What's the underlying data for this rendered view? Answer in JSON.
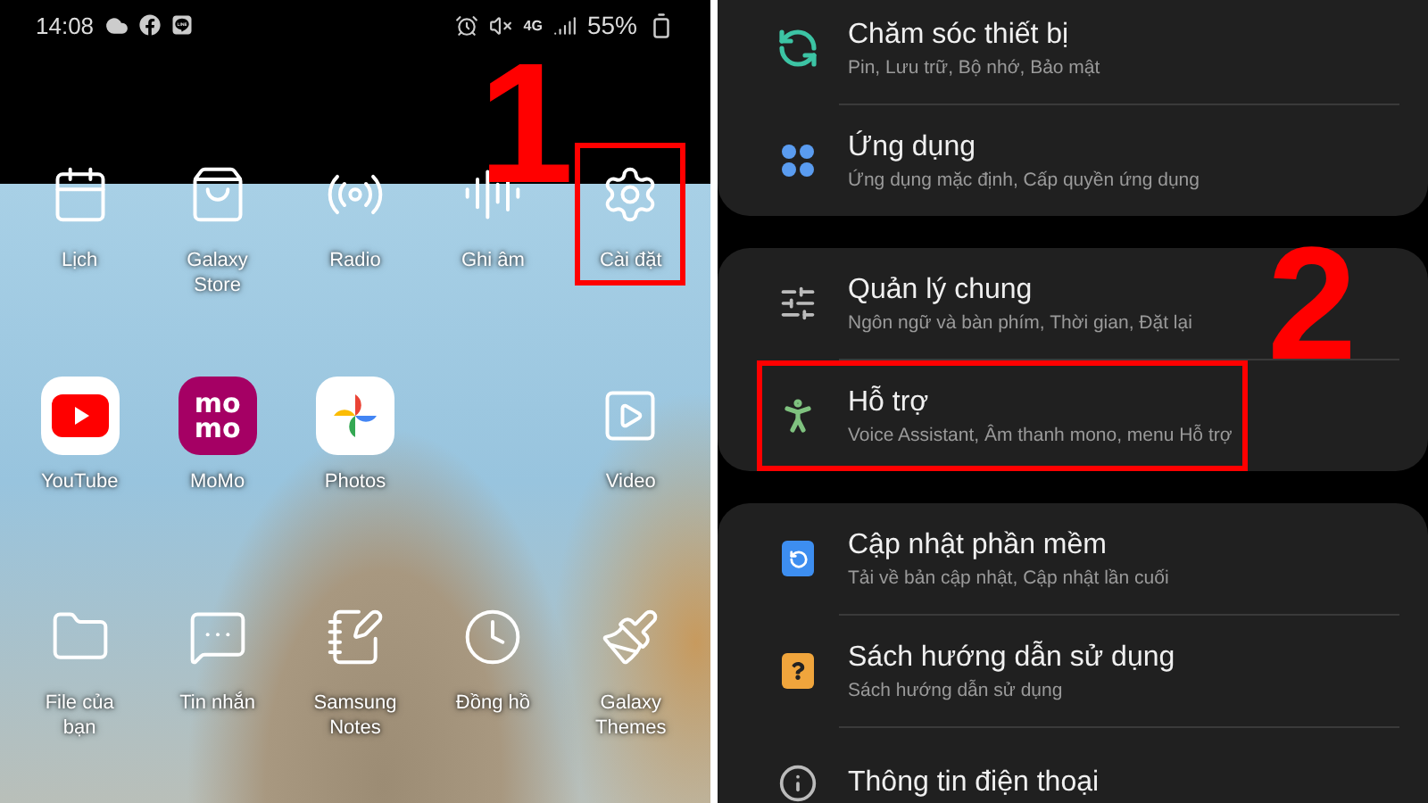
{
  "home_screen": {
    "status_bar": {
      "time": "14:08",
      "network": "4G",
      "battery": "55%"
    },
    "step_label": "1",
    "app_rows": [
      [
        {
          "label": "Lịch",
          "kind": "calendar",
          "highlighted": false
        },
        {
          "label": "Galaxy Store",
          "kind": "store",
          "highlighted": false
        },
        {
          "label": "Radio",
          "kind": "radio",
          "highlighted": false
        },
        {
          "label": "Ghi âm",
          "kind": "recorder",
          "highlighted": false
        },
        {
          "label": "Cài đặt",
          "kind": "settings",
          "highlighted": true
        }
      ],
      [
        {
          "label": "YouTube",
          "kind": "youtube",
          "highlighted": false
        },
        {
          "label": "MoMo",
          "kind": "momo",
          "logo_text": [
            "mo",
            "mo"
          ],
          "highlighted": false
        },
        {
          "label": "Photos",
          "kind": "photos",
          "highlighted": false
        },
        {
          "kind": "empty"
        },
        {
          "label": "Video",
          "kind": "video",
          "highlighted": false
        }
      ],
      [
        {
          "label": "File của bạn",
          "kind": "files",
          "highlighted": false
        },
        {
          "label": "Tin nhắn",
          "kind": "messages",
          "highlighted": false
        },
        {
          "label": "Samsung Notes",
          "kind": "notes",
          "highlighted": false
        },
        {
          "label": "Đồng hồ",
          "kind": "clock",
          "highlighted": false
        },
        {
          "label": "Galaxy Themes",
          "kind": "themes",
          "highlighted": false
        }
      ]
    ]
  },
  "settings": {
    "step_label": "2",
    "groups": [
      {
        "items": [
          {
            "title": "Chăm sóc thiết bị",
            "subtitle": "Pin, Lưu trữ, Bộ nhớ, Bảo mật",
            "kind": "device_care",
            "highlighted": false
          },
          {
            "title": "Ứng dụng",
            "subtitle": "Ứng dụng mặc định, Cấp quyền ứng dụng",
            "kind": "apps",
            "highlighted": false
          }
        ]
      },
      {
        "items": [
          {
            "title": "Quản lý chung",
            "subtitle": "Ngôn ngữ và bàn phím, Thời gian, Đặt lại",
            "kind": "general",
            "highlighted": false
          },
          {
            "title": "Hỗ trợ",
            "subtitle": "Voice Assistant, Âm thanh mono, menu Hỗ trợ",
            "kind": "accessibility",
            "highlighted": true
          }
        ]
      },
      {
        "items": [
          {
            "title": "Cập nhật phần mềm",
            "subtitle": "Tải về bản cập nhật, Cập nhật lần cuối",
            "kind": "update",
            "highlighted": false
          },
          {
            "title": "Sách hướng dẫn sử dụng",
            "subtitle": "Sách hướng dẫn sử dụng",
            "kind": "manual",
            "highlighted": false
          },
          {
            "title": "Thông tin điện thoại",
            "kind": "about",
            "highlighted": false
          }
        ]
      }
    ]
  }
}
